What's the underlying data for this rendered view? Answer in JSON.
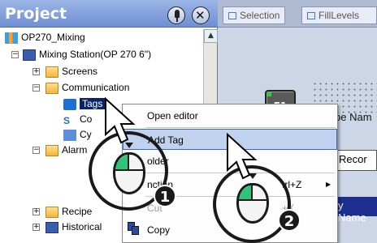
{
  "project_pane": {
    "title": "Project",
    "pin_icon": "pin-icon",
    "close_icon": "close-icon",
    "close_glyph": "✕"
  },
  "tree": {
    "collapse_glyph": "−",
    "expand_glyph": "+",
    "items": [
      {
        "label": "OP270_Mixing",
        "icon": "project-icon"
      },
      {
        "label": "Mixing Station(OP 270 6\")",
        "icon": "device-icon"
      },
      {
        "label": "Screens",
        "icon": "folder-icon"
      },
      {
        "label": "Communication",
        "icon": "folder-icon"
      },
      {
        "label": "Tags",
        "icon": "tags-icon"
      },
      {
        "label": "Co",
        "icon": "connections-icon"
      },
      {
        "label": "Cy",
        "icon": "cycles-icon"
      },
      {
        "label": "Alarm",
        "icon": "folder-icon"
      },
      {
        "label": "Recipe",
        "icon": "folder-icon"
      },
      {
        "label": "Historical",
        "icon": "folder-icon"
      }
    ]
  },
  "workspace": {
    "tabs": [
      {
        "label": "Selection"
      },
      {
        "label": "FillLevels"
      }
    ],
    "f1_label": "F1",
    "recipe_label": "Recipe Nam",
    "reco_label": "Recor",
    "name_label": "y Name"
  },
  "context_menu": {
    "items": [
      {
        "label": "Open editor",
        "shortcut": "",
        "state": "normal"
      },
      {
        "label": "Add Tag",
        "shortcut": "",
        "state": "highlighted"
      },
      {
        "label": "older",
        "shortcut": "",
        "state": "normal"
      },
      {
        "label": "nction",
        "shortcut": "trl+Z",
        "state": "normal",
        "submenu": true
      },
      {
        "label": "Cut",
        "shortcut": "+X",
        "state": "disabled"
      },
      {
        "label": "Copy",
        "shortcut": "",
        "state": "normal"
      }
    ]
  },
  "annotations": {
    "step1": "1",
    "step2": "2"
  }
}
